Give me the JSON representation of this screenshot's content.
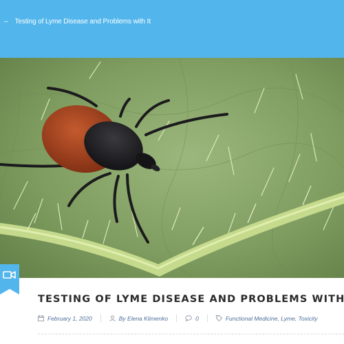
{
  "breadcrumb": {
    "separator": "–",
    "current": "Testing of Lyme Disease and Problems with It"
  },
  "colors": {
    "header_bg": "#52b6ec",
    "meta_text": "#4d6f9c",
    "title_text": "#2a2a2a"
  },
  "hero": {
    "subject": "tick on green leaf"
  },
  "format_badge": {
    "icon": "video-camera-icon"
  },
  "post": {
    "title": "TESTING OF LYME DISEASE AND PROBLEMS WITH IT",
    "date": "February 1, 2020",
    "author_prefix": "By",
    "author": "Elena Klimenko",
    "comments": "0",
    "categories": [
      "Functional Medicine",
      "Lyme",
      "Toxicity"
    ]
  }
}
